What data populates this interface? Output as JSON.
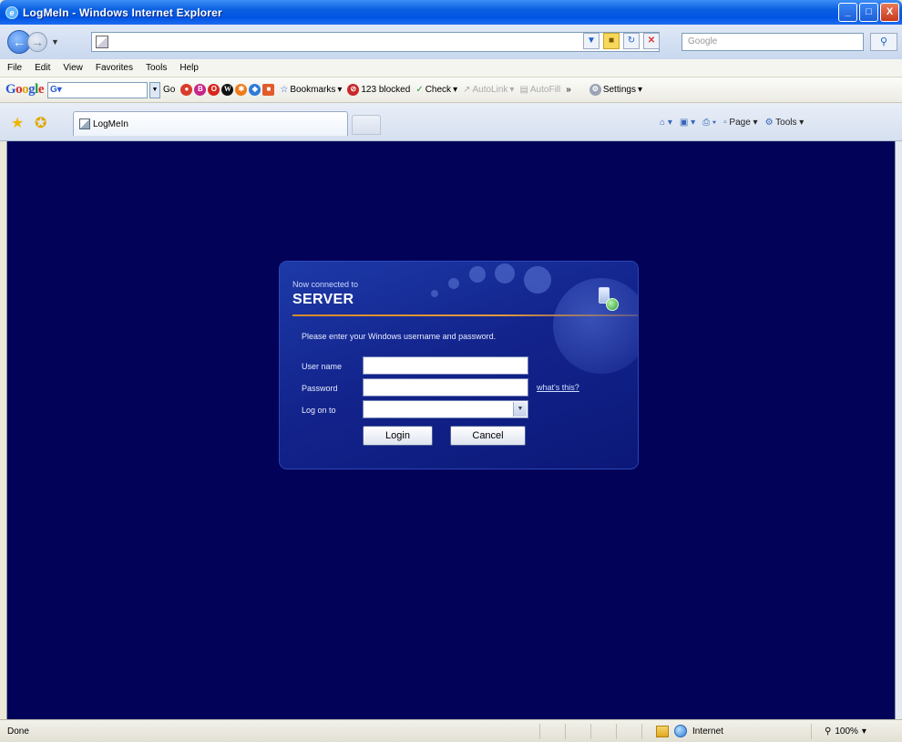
{
  "window": {
    "title": "LogMeIn - Windows Internet Explorer",
    "buttons": [
      "_",
      "□",
      "X"
    ]
  },
  "address_bar": {
    "url": "",
    "search_placeholder": "Google"
  },
  "menu": {
    "items": [
      "File",
      "Edit",
      "View",
      "Favorites",
      "Tools",
      "Help"
    ]
  },
  "google_toolbar": {
    "go_label": "Go",
    "bookmarks_label": "Bookmarks",
    "blocked_label": "123 blocked",
    "check_label": "Check",
    "autolink_label": "AutoLink",
    "autofill_label": "AutoFill",
    "more_label": "»",
    "settings_label": "Settings"
  },
  "tabs": {
    "active_label": "LogMeIn"
  },
  "command_bar": {
    "page_label": "Page",
    "tools_label": "Tools"
  },
  "login": {
    "connected_text": "Now connected to",
    "server_name": "SERVER",
    "prompt": "Please enter your Windows username and password.",
    "username_label": "User name",
    "password_label": "Password",
    "logon_label": "Log on to",
    "whats_this": "what's this?",
    "username_value": "",
    "password_value": "",
    "logon_value": "",
    "login_button": "Login",
    "cancel_button": "Cancel"
  },
  "status_bar": {
    "status_text": "Done",
    "zone_text": "Internet",
    "zoom_text": "100%"
  },
  "colors": {
    "page_background": "#020258",
    "dialog_background": "#13248d",
    "divider_accent": "#e39b3c"
  },
  "icons": [
    "ie-icon",
    "back-arrow-icon",
    "forward-arrow-icon",
    "page-icon",
    "lock-icon",
    "refresh-icon",
    "stop-icon",
    "search-icon",
    "favorites-star-icon",
    "add-favorites-icon",
    "home-icon",
    "feeds-icon",
    "print-icon",
    "server-globe-icon",
    "internet-zone-icon",
    "zoom-icon"
  ]
}
